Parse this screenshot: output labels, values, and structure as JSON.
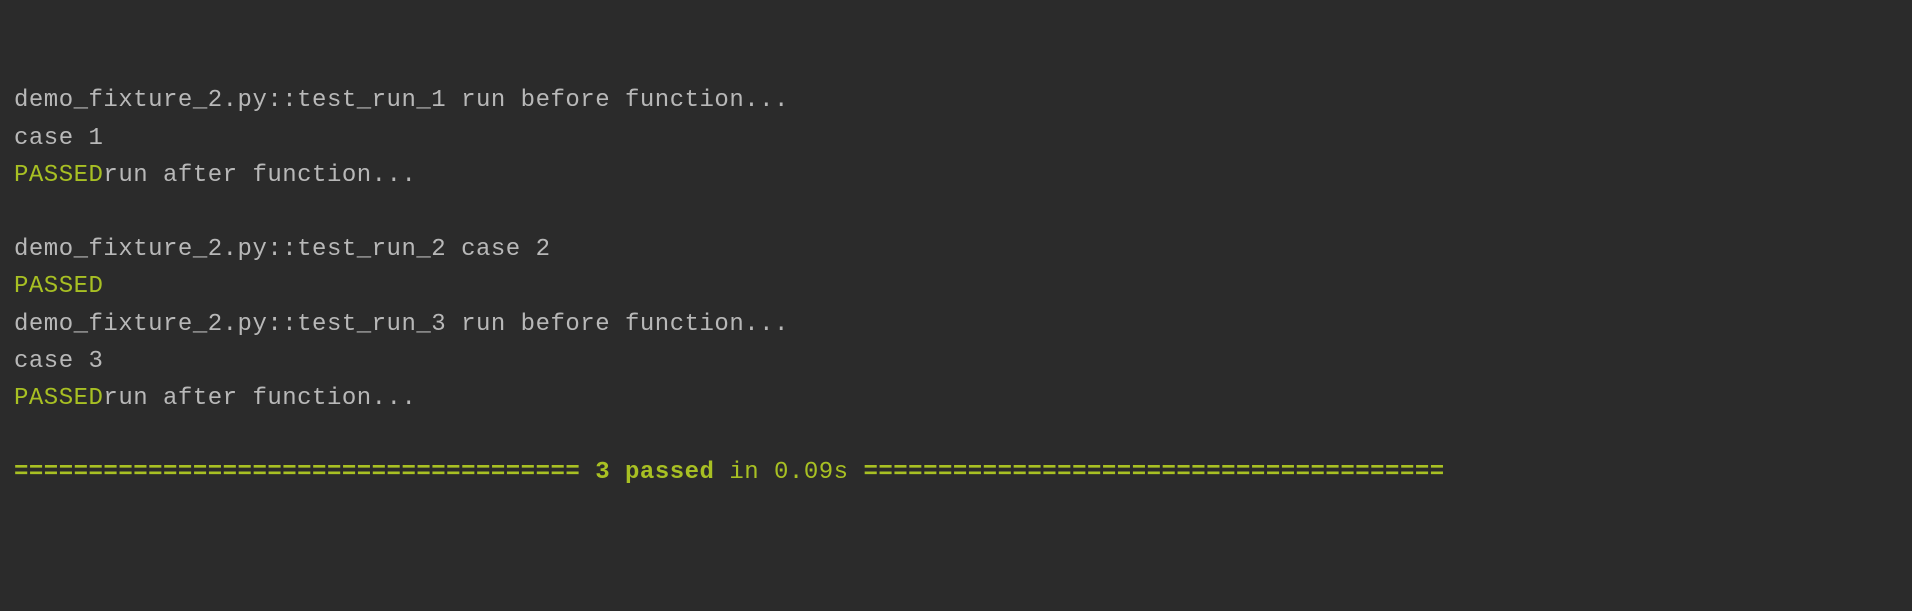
{
  "lines": {
    "test1_header": "demo_fixture_2.py::test_run_1 run before function...",
    "test1_case": "case 1",
    "test1_passed": "PASSED",
    "test1_after": "run after function...",
    "blank": "",
    "test2_header": "demo_fixture_2.py::test_run_2 case 2",
    "test2_passed": "PASSED",
    "test3_header": "demo_fixture_2.py::test_run_3 run before function...",
    "test3_case": "case 3",
    "test3_passed": "PASSED",
    "test3_after": "run after function..."
  },
  "summary": {
    "left_rule": "====================================== ",
    "passed_count": "3 passed",
    "duration": " in 0.09s ",
    "right_rule": "======================================="
  }
}
